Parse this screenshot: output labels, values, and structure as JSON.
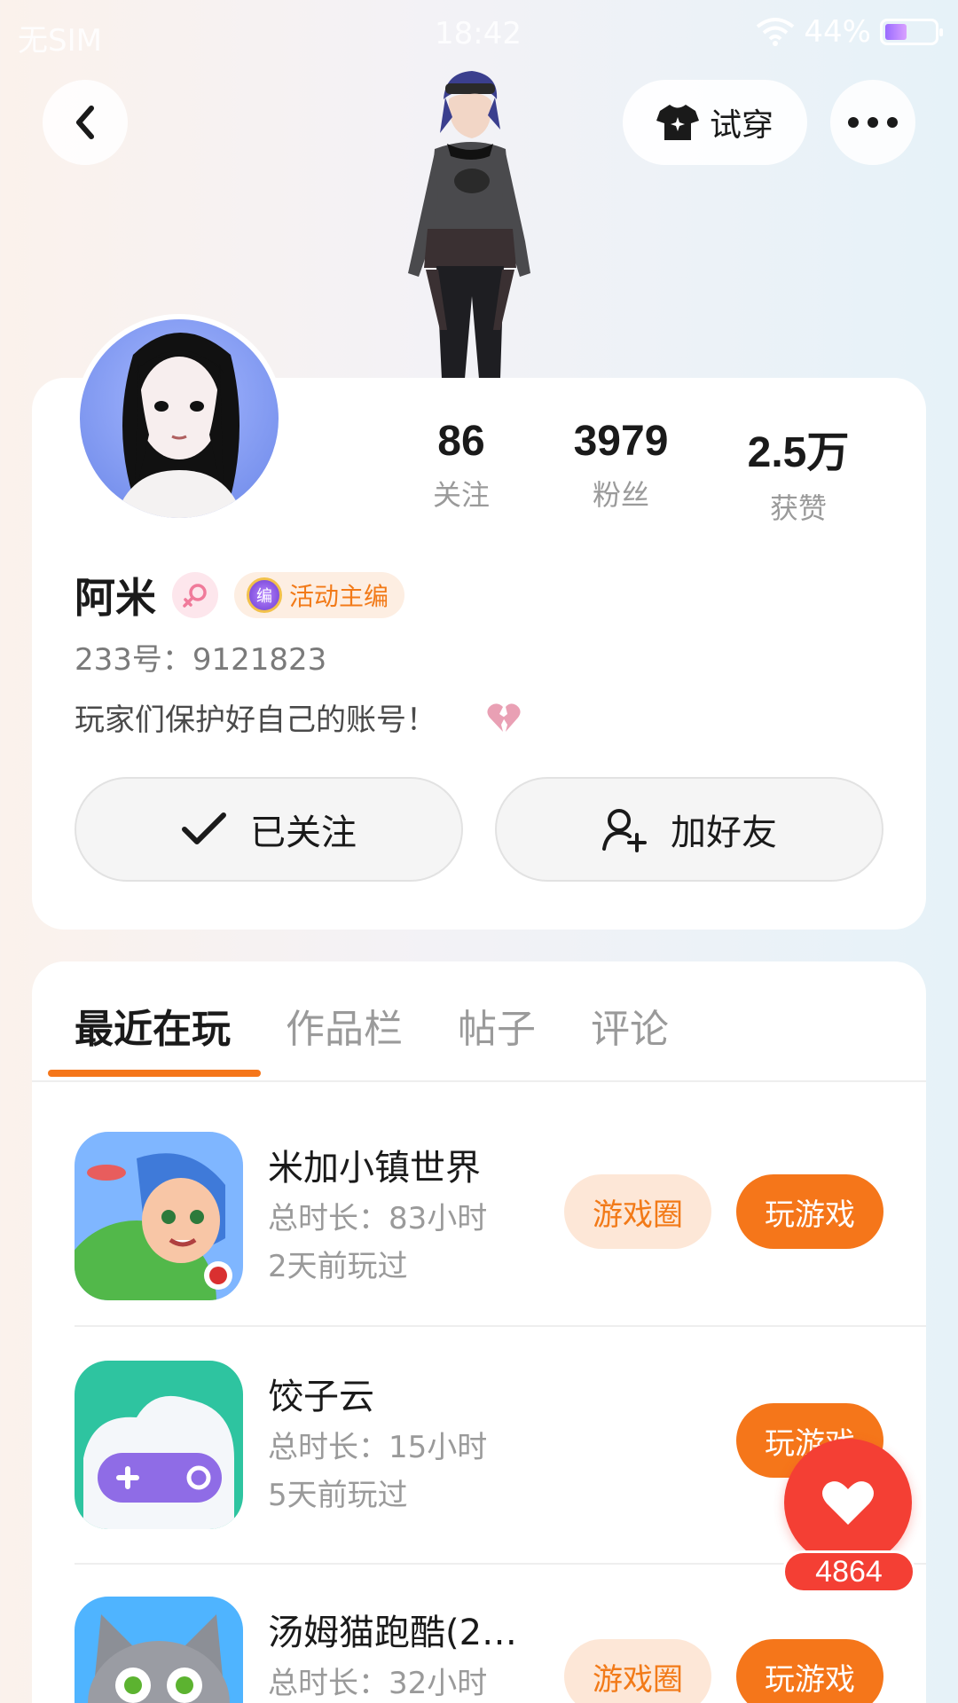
{
  "status_bar": {
    "carrier": "无SIM",
    "time": "18:42",
    "battery": "44%"
  },
  "header": {
    "try_on_label": "试穿"
  },
  "profile": {
    "stats": [
      {
        "value": "86",
        "label": "关注"
      },
      {
        "value": "3979",
        "label": "粉丝"
      },
      {
        "value": "2.5万",
        "label": "获赞"
      }
    ],
    "name": "阿米",
    "role_badge": "活动主编",
    "role_badge_icon_text": "编",
    "id_text": "233号：9121823",
    "bio": "玩家们保护好自己的账号！",
    "follow_label": "已关注",
    "add_friend_label": "加好友"
  },
  "tabs": [
    "最近在玩",
    "作品栏",
    "帖子",
    "评论"
  ],
  "games": [
    {
      "title": "米加小镇世界",
      "time": "总时长：83小时",
      "last_played": "2天前玩过",
      "circle_label": "游戏圈",
      "play_label": "玩游戏"
    },
    {
      "title": "饺子云",
      "time": "总时长：15小时",
      "last_played": "5天前玩过",
      "play_label": "玩游戏"
    },
    {
      "title": "汤姆猫跑酷(2…",
      "time": "总时长：32小时",
      "circle_label": "游戏圈",
      "play_label": "玩游戏"
    }
  ],
  "like": {
    "count": "4864"
  },
  "colors": {
    "accent": "#f5761a",
    "like": "#f43f34"
  }
}
